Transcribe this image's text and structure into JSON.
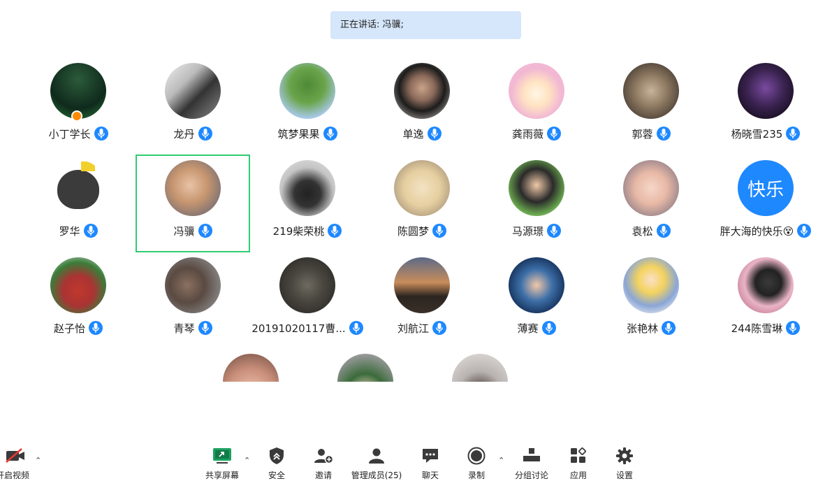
{
  "speaker_banner": "正在讲话: 冯骥;",
  "participants": [
    {
      "name": "小丁学长",
      "host": true
    },
    {
      "name": "龙丹"
    },
    {
      "name": "筑梦果果"
    },
    {
      "name": "单逸"
    },
    {
      "name": "龚雨薇"
    },
    {
      "name": "郭蓉"
    },
    {
      "name": "杨晓雪235"
    },
    {
      "name": "罗华"
    },
    {
      "name": "冯骥",
      "active": true
    },
    {
      "name": "219柴荣桃"
    },
    {
      "name": "陈圆梦"
    },
    {
      "name": "马源璟"
    },
    {
      "name": "袁松"
    },
    {
      "name": "胖大海的快乐😵",
      "avatar_text": "快乐"
    },
    {
      "name": "赵子怡"
    },
    {
      "name": "青琴"
    },
    {
      "name": "20191020117曹..."
    },
    {
      "name": "刘航江"
    },
    {
      "name": "薄赛"
    },
    {
      "name": "张艳林"
    },
    {
      "name": "244陈雪琳"
    }
  ],
  "toolbar": {
    "video": "开启视频",
    "share_screen": "共享屏幕",
    "security": "安全",
    "invite": "邀请",
    "manage_members": "管理成员(25)",
    "chat": "聊天",
    "record": "录制",
    "breakout": "分组讨论",
    "apps": "应用",
    "settings": "设置"
  },
  "colors": {
    "accent": "#1e88ff",
    "active_border": "#2ecc71",
    "banner_bg": "#d6e6fb",
    "host_badge": "#ff8a00",
    "share_green": "#1aa260",
    "video_off_red": "#e53935"
  }
}
